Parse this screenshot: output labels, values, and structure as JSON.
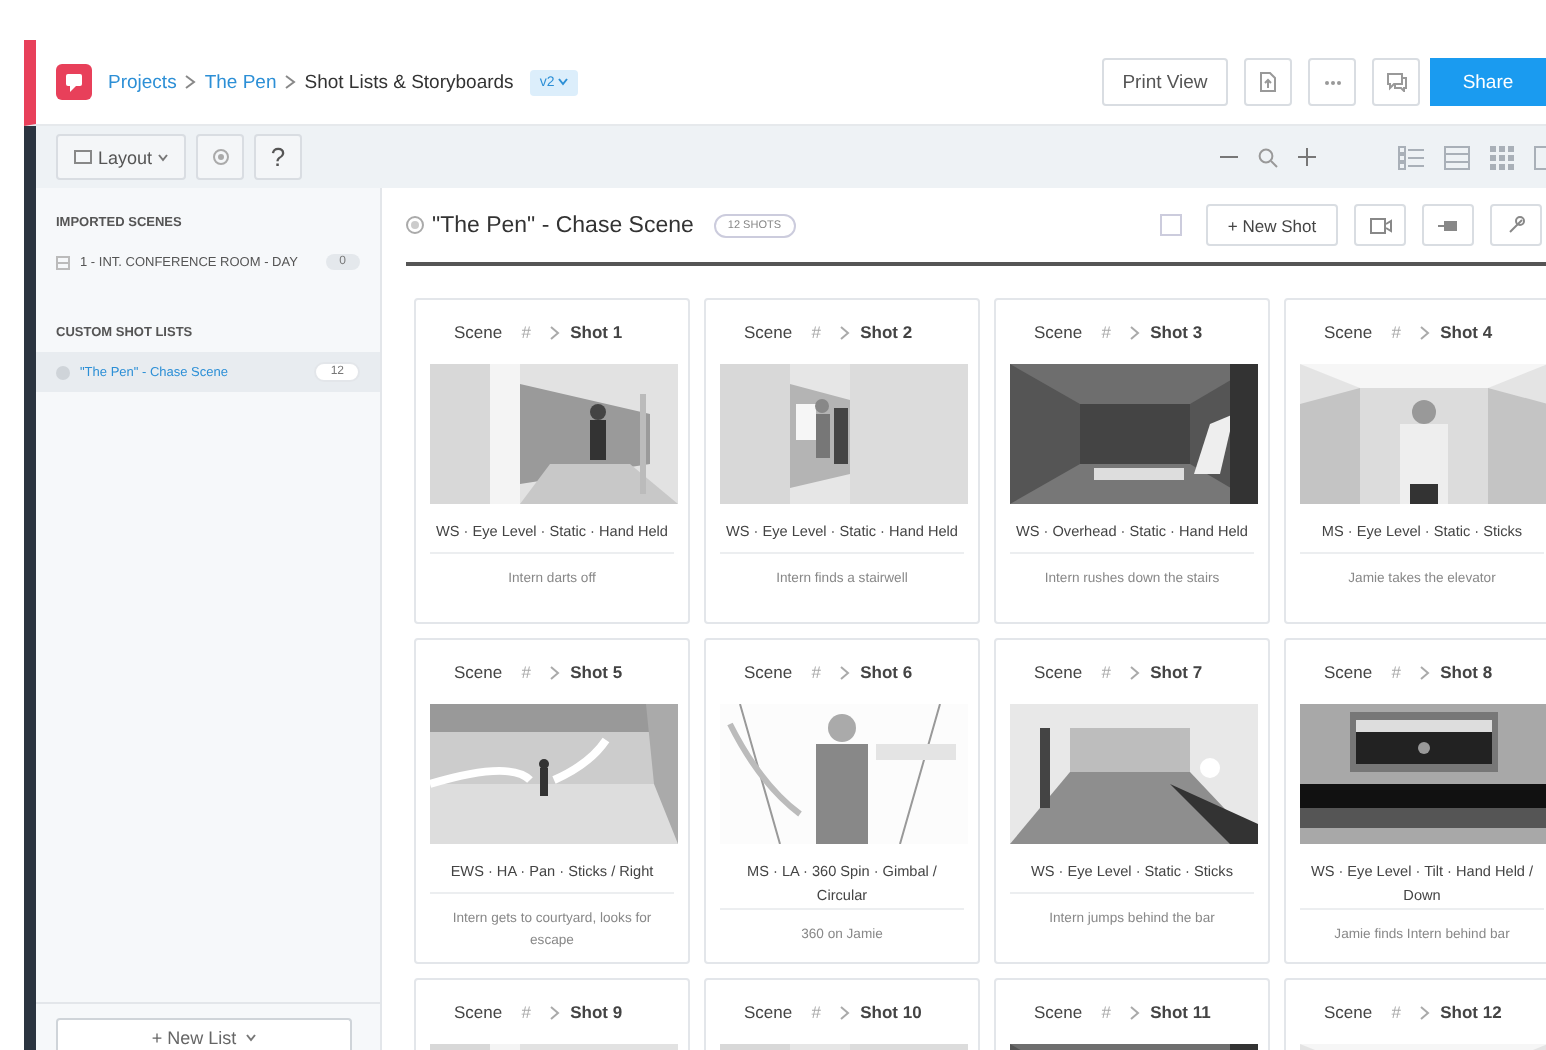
{
  "header": {
    "breadcrumb": [
      {
        "label": "Projects",
        "kind": "link"
      },
      {
        "label": "The Pen",
        "kind": "link"
      },
      {
        "label": "Shot Lists & Storyboards",
        "kind": "current"
      }
    ],
    "version": "v2",
    "print_view": "Print View",
    "share": "Share"
  },
  "toolbar": {
    "layout": "Layout",
    "help": "?"
  },
  "sidebar": {
    "sections": [
      {
        "title": "IMPORTED SCENES",
        "kind": "scene",
        "items": [
          {
            "label": "1 - INT. CONFERENCE ROOM - DAY",
            "count": "0",
            "selected": false
          }
        ]
      },
      {
        "title": "CUSTOM SHOT LISTS",
        "kind": "list",
        "items": [
          {
            "label": "\"The Pen\" - Chase Scene",
            "count": "12",
            "selected": true
          }
        ]
      }
    ],
    "new_list": "+ New List"
  },
  "main": {
    "title": "\"The Pen\" - Chase Scene",
    "badge": "12 SHOTS",
    "new_shot": "+ New Shot",
    "select_all": {
      "checked": false
    },
    "shots": [
      {
        "scene": "Scene",
        "scene_number": "#",
        "shot": "Shot 1",
        "tags": "WS · Eye Level · Static · Hand Held",
        "description": "Intern darts off"
      },
      {
        "scene": "Scene",
        "scene_number": "#",
        "shot": "Shot 2",
        "tags": "WS · Eye Level · Static · Hand Held",
        "description": "Intern finds a stairwell"
      },
      {
        "scene": "Scene",
        "scene_number": "#",
        "shot": "Shot 3",
        "tags": "WS · Overhead · Static · Hand Held",
        "description": "Intern rushes down the stairs"
      },
      {
        "scene": "Scene",
        "scene_number": "#",
        "shot": "Shot 4",
        "tags": "MS · Eye Level · Static · Sticks",
        "description": "Jamie takes the elevator"
      },
      {
        "scene": "Scene",
        "scene_number": "#",
        "shot": "Shot 5",
        "tags": "EWS · HA · Pan · Sticks / Right",
        "description": "Intern gets to courtyard, looks for escape"
      },
      {
        "scene": "Scene",
        "scene_number": "#",
        "shot": "Shot 6",
        "tags": "MS · LA · 360 Spin · Gimbal / Circular",
        "description": "360 on Jamie"
      },
      {
        "scene": "Scene",
        "scene_number": "#",
        "shot": "Shot 7",
        "tags": "WS · Eye Level · Static · Sticks",
        "description": "Intern jumps behind the bar"
      },
      {
        "scene": "Scene",
        "scene_number": "#",
        "shot": "Shot 8",
        "tags": "WS · Eye Level · Tilt · Hand Held / Down",
        "description": "Jamie finds Intern behind bar"
      },
      {
        "scene": "Scene",
        "scene_number": "#",
        "shot": "Shot 9"
      },
      {
        "scene": "Scene",
        "scene_number": "#",
        "shot": "Shot 10"
      },
      {
        "scene": "Scene",
        "scene_number": "#",
        "shot": "Shot 11"
      },
      {
        "scene": "Scene",
        "scene_number": "#",
        "shot": "Shot 12"
      }
    ]
  }
}
